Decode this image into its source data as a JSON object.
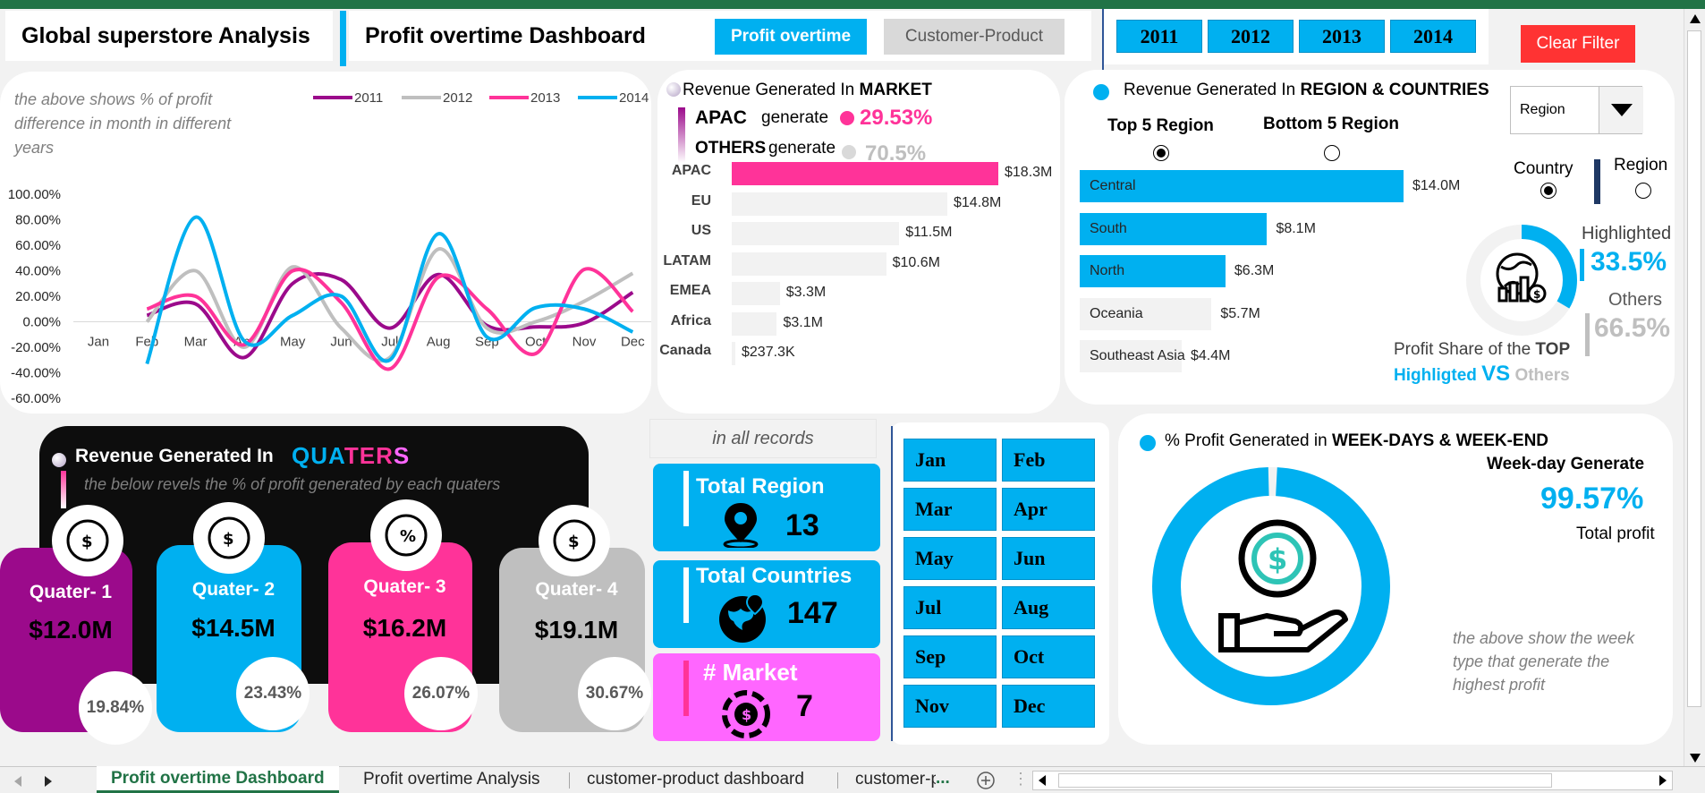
{
  "header": {
    "app_title": "Global superstore Analysis",
    "dashboard_title": "Profit overtime Dashboard",
    "tab_profit": "Profit overtime",
    "tab_customer": "Customer-Product",
    "years": [
      "2011",
      "2012",
      "2013",
      "2014"
    ],
    "clear_filter": "Clear Filter"
  },
  "colors": {
    "y2011": "#9b0a8b",
    "y2012": "#bfbfbf",
    "y2013": "#ff3399",
    "y2014": "#00b0f0",
    "cyan": "#00b0f0",
    "pink": "#ff3399",
    "magenta": "#ff66ff"
  },
  "line_card": {
    "note": "the above shows % of profit difference in month in different years"
  },
  "chart_data": {
    "type": "line",
    "categories": [
      "Jan",
      "Feb",
      "Mar",
      "Apr",
      "May",
      "Jun",
      "Jul",
      "Aug",
      "Sep",
      "Oct",
      "Nov",
      "Dec"
    ],
    "y_ticks": [
      "100.00%",
      "80.00%",
      "60.00%",
      "40.00%",
      "20.00%",
      "0.00%",
      "-20.00%",
      "-40.00%",
      "-60.00%"
    ],
    "ylim": [
      -60,
      100
    ],
    "series": [
      {
        "name": "2011",
        "values": [
          null,
          5,
          14,
          -28,
          30,
          33,
          -5,
          37,
          -3,
          -4,
          -1,
          23
        ]
      },
      {
        "name": "2012",
        "values": [
          null,
          0,
          40,
          -20,
          43,
          -5,
          -28,
          57,
          -5,
          0,
          16,
          38
        ]
      },
      {
        "name": "2013",
        "values": [
          null,
          10,
          20,
          -18,
          40,
          15,
          -37,
          35,
          10,
          -25,
          41,
          8
        ]
      },
      {
        "name": "2014",
        "values": [
          null,
          -33,
          82,
          -15,
          5,
          20,
          -30,
          69,
          -12,
          11,
          10,
          -8
        ]
      }
    ]
  },
  "market_card": {
    "title_prefix": "Revenue Generated In ",
    "title_bold": "MARKET",
    "apac_label": "APAC",
    "generate_1": "generate",
    "apac_pct": "29.53%",
    "others_label": "OTHERS",
    "generate_2": "generate",
    "others_pct": "70.5%",
    "bars": [
      {
        "label": "APAC",
        "value": 18.3,
        "text": "$18.3M"
      },
      {
        "label": "EU",
        "value": 14.8,
        "text": "$14.8M"
      },
      {
        "label": "US",
        "value": 11.5,
        "text": "$11.5M"
      },
      {
        "label": "LATAM",
        "value": 10.6,
        "text": "$10.6M"
      },
      {
        "label": "EMEA",
        "value": 3.3,
        "text": "$3.3M"
      },
      {
        "label": "Africa",
        "value": 3.1,
        "text": "$3.1M"
      },
      {
        "label": "Canada",
        "value": 0.237,
        "text": "$237.3K"
      }
    ]
  },
  "region_card": {
    "title_prefix": "Revenue Generated In ",
    "title_bold": "REGION & COUNTRIES",
    "top_label": "Top  5 Region",
    "bottom_label": "Bottom 5 Region",
    "dropdown_value": "Region",
    "country_label": "Country",
    "region_label": "Region",
    "bars": [
      {
        "label": "Central",
        "value": 14.0,
        "text": "$14.0M"
      },
      {
        "label": "South",
        "value": 8.1,
        "text": "$8.1M"
      },
      {
        "label": "North",
        "value": 6.3,
        "text": "$6.3M"
      },
      {
        "label": "Oceania",
        "value": 5.7,
        "text": "$5.7M"
      },
      {
        "label": "Southeast Asia",
        "value": 4.4,
        "text": "$4.4M"
      }
    ],
    "highlighted_label": "Highlighted",
    "highlighted_pct": "33.5%",
    "highlighted_share": 0.335,
    "others_label": "Others",
    "others_pct": "66.5%",
    "share_caption_1": "Profit Share of the ",
    "share_caption_top": "TOP",
    "share_caption_hl": "Highligted ",
    "share_caption_vs": "VS",
    "share_caption_others": " Others"
  },
  "quarter_card": {
    "title_prefix": "Revenue Generated In ",
    "title_word": "QUATERS",
    "note": "the below revels the % of profit generated  by each quaters",
    "quarters": [
      {
        "name": "Quater- 1",
        "value": "$12.0M",
        "pct": "19.84%"
      },
      {
        "name": "Quater- 2",
        "value": "$14.5M",
        "pct": "23.43%"
      },
      {
        "name": "Quater- 3",
        "value": "$16.2M",
        "pct": "26.07%"
      },
      {
        "name": "Quater- 4",
        "value": "$19.1M",
        "pct": "30.67%"
      }
    ]
  },
  "kpis": {
    "caption": "in all records",
    "region_label": "Total Region",
    "region_value": "13",
    "countries_label": "Total Countries",
    "countries_value": "147",
    "market_label": "# Market",
    "market_value": "7"
  },
  "months": [
    "Jan",
    "Feb",
    "Mar",
    "Apr",
    "May",
    "Jun",
    "Jul",
    "Aug",
    "Sep",
    "Oct",
    "Nov",
    "Dec"
  ],
  "week_card": {
    "title_prefix": "% Profit Generated in ",
    "title_bold": "WEEK-DAYS & WEEK-END",
    "weekday_label": "Week-day Generate",
    "weekday_pct": "99.57%",
    "weekday_share": 0.9957,
    "total_label": "Total profit",
    "note": "the above show the week type that generate the highest profit"
  },
  "sheet_tabs": [
    "Profit overtime Dashboard",
    "Profit overtime Analysis",
    "customer-product dashboard",
    "customer-p"
  ]
}
